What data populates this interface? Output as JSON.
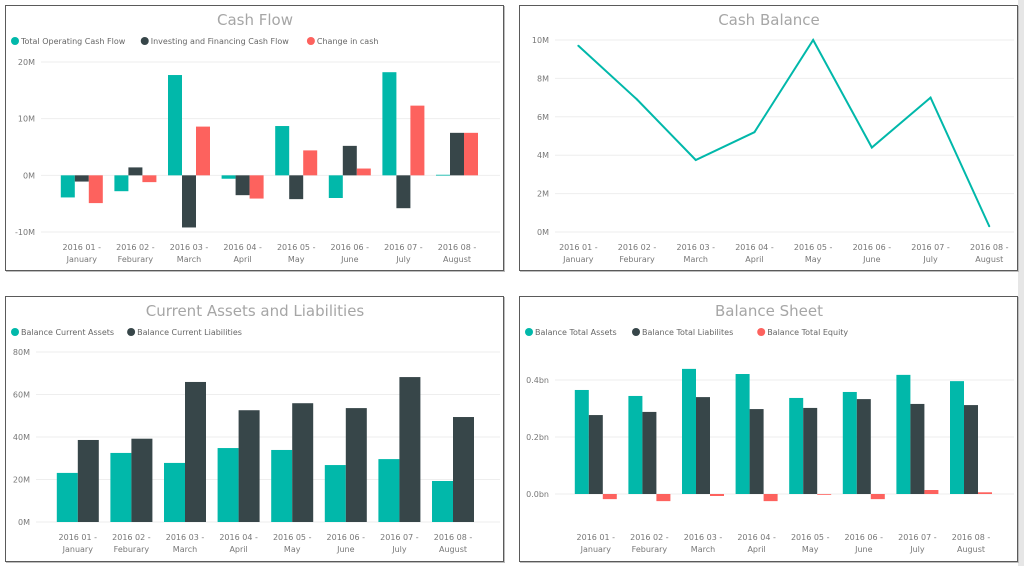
{
  "colors": {
    "teal": "#01B8AA",
    "dark": "#374649",
    "red": "#FD625E"
  },
  "chart_data": [
    {
      "id": "cash-flow",
      "type": "bar",
      "title": "Cash Flow",
      "categories": [
        [
          "2016 01 -",
          "January"
        ],
        [
          "2016 02 -",
          "Feburary"
        ],
        [
          "2016 03 -",
          "March"
        ],
        [
          "2016 04 -",
          "April"
        ],
        [
          "2016 05 -",
          "May"
        ],
        [
          "2016 06 -",
          "June"
        ],
        [
          "2016 07 -",
          "July"
        ],
        [
          "2016 08 -",
          "August"
        ]
      ],
      "series": [
        {
          "name": "Total Operating Cash Flow",
          "color": "#01B8AA",
          "values": [
            -3.9,
            -2.8,
            17.7,
            -0.6,
            8.7,
            -4.0,
            18.2,
            0.1
          ]
        },
        {
          "name": "Investing and Financing Cash Flow",
          "color": "#374649",
          "values": [
            -1.1,
            1.4,
            -9.2,
            -3.5,
            -4.2,
            5.2,
            -5.8,
            7.5
          ]
        },
        {
          "name": "Change in cash",
          "color": "#FD625E",
          "values": [
            -4.9,
            -1.2,
            8.6,
            -4.1,
            4.4,
            1.2,
            12.3,
            7.5
          ]
        }
      ],
      "unit": "M",
      "yticks": [
        "20M",
        "10M",
        "0M",
        "-10M"
      ],
      "ytick_values": [
        20,
        10,
        0,
        -10
      ],
      "ylim": [
        -10,
        20
      ],
      "xlabel": "",
      "ylabel": "",
      "legend": "top-left",
      "grid": true
    },
    {
      "id": "cash-balance",
      "type": "line",
      "title": "Cash Balance",
      "categories": [
        [
          "2016 01 -",
          "January"
        ],
        [
          "2016 02 -",
          "Feburary"
        ],
        [
          "2016 03 -",
          "March"
        ],
        [
          "2016 04 -",
          "April"
        ],
        [
          "2016 05 -",
          "May"
        ],
        [
          "2016 06 -",
          "June"
        ],
        [
          "2016 07 -",
          "July"
        ],
        [
          "2016 08 -",
          "August"
        ]
      ],
      "series": [
        {
          "name": "Cash Balance",
          "color": "#01B8AA",
          "values": [
            9.7,
            6.9,
            3.75,
            5.2,
            10.0,
            4.4,
            7.0,
            0.3
          ]
        }
      ],
      "unit": "M",
      "yticks": [
        "10M",
        "8M",
        "6M",
        "4M",
        "2M",
        "0M"
      ],
      "ytick_values": [
        10,
        8,
        6,
        4,
        2,
        0
      ],
      "ylim": [
        0,
        10
      ],
      "xlabel": "",
      "ylabel": "",
      "legend": "none",
      "grid": true
    },
    {
      "id": "current-assets-liabilities",
      "type": "bar",
      "title": "Current Assets and Liabilities",
      "categories": [
        [
          "2016 01 -",
          "January"
        ],
        [
          "2016 02 -",
          "Feburary"
        ],
        [
          "2016 03 -",
          "March"
        ],
        [
          "2016 04 -",
          "April"
        ],
        [
          "2016 05 -",
          "May"
        ],
        [
          "2016 06 -",
          "June"
        ],
        [
          "2016 07 -",
          "July"
        ],
        [
          "2016 08 -",
          "August"
        ]
      ],
      "series": [
        {
          "name": "Balance Current Assets",
          "color": "#01B8AA",
          "values": [
            23.1,
            32.5,
            27.8,
            34.8,
            33.9,
            26.8,
            29.6,
            19.3
          ]
        },
        {
          "name": "Balance Current Liabilities",
          "color": "#374649",
          "values": [
            38.6,
            39.2,
            65.9,
            52.6,
            55.9,
            53.6,
            68.2,
            49.4
          ]
        }
      ],
      "unit": "M",
      "yticks": [
        "80M",
        "60M",
        "40M",
        "20M",
        "0M"
      ],
      "ytick_values": [
        80,
        60,
        40,
        20,
        0
      ],
      "ylim": [
        0,
        80
      ],
      "xlabel": "",
      "ylabel": "",
      "legend": "top-left",
      "grid": true
    },
    {
      "id": "balance-sheet",
      "type": "bar",
      "title": "Balance Sheet",
      "categories": [
        [
          "2016 01 -",
          "January"
        ],
        [
          "2016 02 -",
          "Feburary"
        ],
        [
          "2016 03 -",
          "March"
        ],
        [
          "2016 04 -",
          "April"
        ],
        [
          "2016 05 -",
          "May"
        ],
        [
          "2016 06 -",
          "June"
        ],
        [
          "2016 07 -",
          "July"
        ],
        [
          "2016 08 -",
          "August"
        ]
      ],
      "series": [
        {
          "name": "Balance Total Assets",
          "color": "#01B8AA",
          "values": [
            0.365,
            0.344,
            0.439,
            0.421,
            0.337,
            0.358,
            0.418,
            0.396
          ]
        },
        {
          "name": "Balance Total Liabilites",
          "color": "#374649",
          "values": [
            0.277,
            0.288,
            0.34,
            0.298,
            0.302,
            0.333,
            0.316,
            0.312
          ]
        },
        {
          "name": "Balance Total Equity",
          "color": "#FD625E",
          "values": [
            -0.018,
            -0.025,
            -0.007,
            -0.025,
            -0.002,
            -0.018,
            0.014,
            0.006
          ]
        }
      ],
      "unit": "bn",
      "yticks": [
        "0.4bn",
        "0.2bn",
        "0.0bn"
      ],
      "ytick_values": [
        0.4,
        0.2,
        0.0
      ],
      "ylim": [
        -0.1,
        0.5
      ],
      "xlabel": "",
      "ylabel": "",
      "legend": "top-left",
      "grid": true
    }
  ]
}
